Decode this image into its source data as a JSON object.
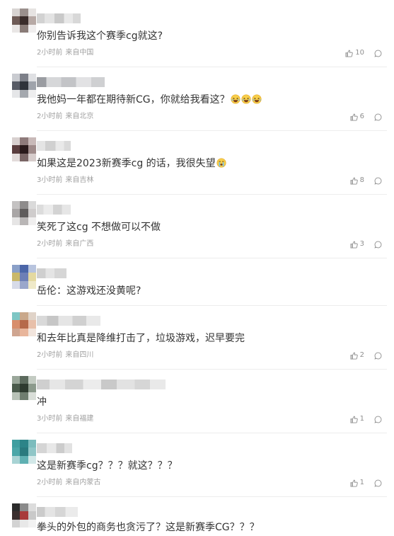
{
  "icons": {
    "like": "thumbs-up-icon",
    "reply": "comment-icon",
    "avatar": "pixelated-avatar",
    "username": "pixelated-username"
  },
  "comments": [
    {
      "text": "你别告诉我这个赛季cg就这?",
      "time": "2小时前",
      "location": "来自中国",
      "likes": "10",
      "avatar_colors": [
        "#d8d4d2",
        "#9a8f8c",
        "#e6e3e2",
        "#6e5b56",
        "#3a2c2a",
        "#b7a9a5",
        "#e9e6e5",
        "#8a7c78",
        "#f0eeee"
      ]
    },
    {
      "text": "我他妈一年都在期待新CG，你就给我看这？",
      "emoji": [
        "laughing-emoji-icon",
        "laughing-emoji-icon",
        "laughing-emoji-icon"
      ],
      "time": "2小时前",
      "location": "来自北京",
      "likes": "6",
      "avatar_colors": [
        "#c9cbd0",
        "#7d8089",
        "#dfe0e3",
        "#585c66",
        "#2f333b",
        "#9fa3ab",
        "#e5e6e8",
        "#a4a8ae",
        "#eeeeef"
      ]
    },
    {
      "text": "如果这是2023新赛季cg 的话，我很失望",
      "emoji": [
        "crying-emoji-icon"
      ],
      "time": "3小时前",
      "location": "来自吉林",
      "likes": "8",
      "avatar_colors": [
        "#d8d0cf",
        "#8e7a7a",
        "#c8b9b8",
        "#5a3d3e",
        "#2a1a1b",
        "#9f8b8a",
        "#e2dbda",
        "#7a6666",
        "#d6cccb"
      ]
    },
    {
      "text": "笑死了这cg 不想做可以不做",
      "time": "2小时前",
      "location": "来自广西",
      "likes": "3",
      "avatar_colors": [
        "#c4c2c2",
        "#8e8c8c",
        "#dadada",
        "#a9a6a6",
        "#5f5c5c",
        "#cfcccc",
        "#e6e5e5",
        "#b9b6b6",
        "#f0efef"
      ]
    },
    {
      "text": "岳伦：这游戏还没黄呢?",
      "avatar_colors": [
        "#8aa0c8",
        "#4b66a8",
        "#b8c4de",
        "#c9b86a",
        "#6d7fb6",
        "#e4d9a0",
        "#d7dbe8",
        "#9aa7cb",
        "#efe9c8"
      ]
    },
    {
      "text": "和去年比真是降维打击了，垃圾游戏，迟早要完",
      "time": "2小时前",
      "location": "来自四川",
      "likes": "2",
      "avatar_colors": [
        "#7ec6c4",
        "#c9a88b",
        "#e0d3c8",
        "#d88e6c",
        "#b66a4a",
        "#e8c0aa",
        "#cfa590",
        "#e8b59b",
        "#f2e5dd"
      ]
    },
    {
      "text": "冲",
      "time": "3小时前",
      "location": "来自福建",
      "likes": "1",
      "avatar_colors": [
        "#9aa79a",
        "#5c6a5d",
        "#c3cbc2",
        "#4a5a4b",
        "#2e3a2f",
        "#8c9a8c",
        "#b8c2b7",
        "#6f7d6f",
        "#d9ded8"
      ]
    },
    {
      "text": "这是新赛季cg？？？就这？？？",
      "time": "2小时前",
      "location": "来自内蒙古",
      "likes": "1",
      "avatar_colors": [
        "#3f9ea0",
        "#2d8488",
        "#7cbcbd",
        "#4aa6a8",
        "#2a7a7e",
        "#8fc6c7",
        "#a8d3d4",
        "#5fb0b2",
        "#d2e8e8"
      ]
    },
    {
      "text": "拳头的外包的商务也贪污了？这是新赛季CG？？？",
      "avatar_colors": [
        "#2b2b2b",
        "#8a8a8a",
        "#dcdcdc",
        "#3a2e2e",
        "#a83a3a",
        "#c9c9c9",
        "#d3d3d3",
        "#e8e8e8",
        "#f2f2f2"
      ]
    }
  ]
}
